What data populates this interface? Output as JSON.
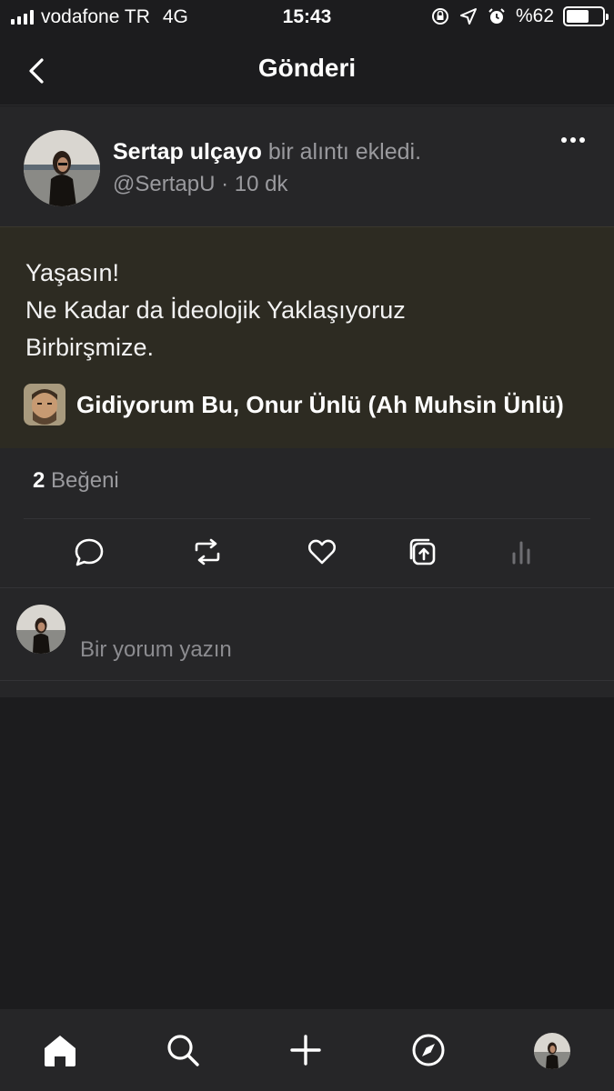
{
  "status_bar": {
    "carrier": "vodafone TR",
    "network": "4G",
    "time": "15:43",
    "battery_label": "%62",
    "battery_level": 0.62
  },
  "header": {
    "title": "Gönderi",
    "back_icon": "chevron-left-icon"
  },
  "post": {
    "author_name": "Sertap ulçayo",
    "action_text": "bir alıntı ekledi.",
    "handle": "@SertapU",
    "time_ago": "10 dk",
    "quote_lines": [
      "Yaşasın!",
      "Ne Kadar da İdeolojik Yaklaşıyoruz",
      "Birbirşmize."
    ],
    "source": "Gidiyorum Bu, Onur Ünlü (Ah Muhsin Ünlü)",
    "likes_count": "2",
    "likes_label": "Beğeni",
    "comment_placeholder": "Bir yorum yazın"
  },
  "actions": [
    "comment-icon",
    "repost-icon",
    "heart-icon",
    "share-icon",
    "stats-icon"
  ],
  "tabs": [
    "home-icon",
    "search-icon",
    "plus-icon",
    "compass-icon",
    "profile-avatar"
  ],
  "colors": {
    "background": "#1c1c1e",
    "card": "#262628",
    "quote_background": "#2d2b22",
    "muted_text": "#9a9a9e"
  }
}
